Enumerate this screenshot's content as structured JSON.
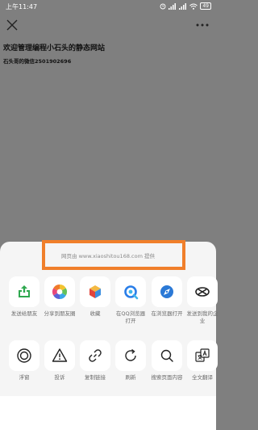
{
  "status": {
    "time": "上午11:47",
    "battery": "49"
  },
  "page": {
    "title": "欢迎管理编程小石头的静态网站",
    "subtitle": "石头哥的微信2501902696"
  },
  "sheet": {
    "provider": "网页由 www.xiaoshitou168.com 提供",
    "row1": [
      {
        "label": "发送给朋友",
        "icon": "share-icon"
      },
      {
        "label": "分享到朋友圈",
        "icon": "moments-icon"
      },
      {
        "label": "收藏",
        "icon": "favorite-icon"
      },
      {
        "label": "在QQ浏览器打开",
        "icon": "qq-browser-icon"
      },
      {
        "label": "在浏览器打开",
        "icon": "browser-icon"
      },
      {
        "label": "发送到我的企业",
        "icon": "work-icon"
      }
    ],
    "row2": [
      {
        "label": "浮窗",
        "icon": "float-window-icon"
      },
      {
        "label": "投诉",
        "icon": "warning-icon"
      },
      {
        "label": "复制链接",
        "icon": "link-icon"
      },
      {
        "label": "刷新",
        "icon": "refresh-icon"
      },
      {
        "label": "搜索页面内容",
        "icon": "search-icon"
      },
      {
        "label": "全文翻译",
        "icon": "translate-icon"
      }
    ]
  },
  "colors": {
    "highlight": "#f07f2b",
    "share_green": "#2fa84f",
    "qq_blue": "#2a7ee8"
  }
}
